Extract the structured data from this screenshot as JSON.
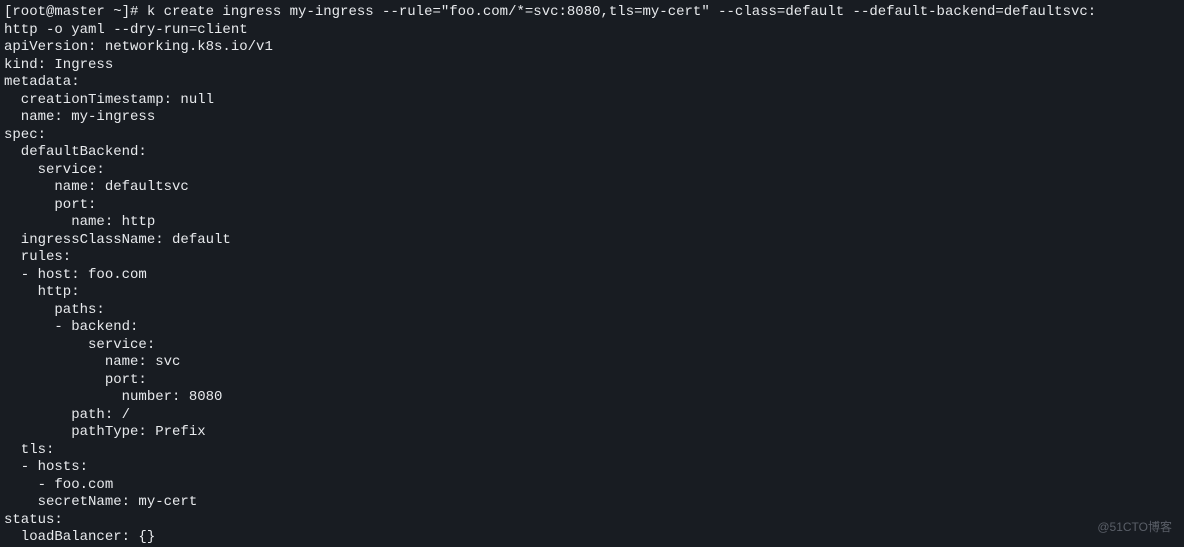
{
  "terminal": {
    "lines": [
      "[root@master ~]# k create ingress my-ingress --rule=\"foo.com/*=svc:8080,tls=my-cert\" --class=default --default-backend=defaultsvc:",
      "http -o yaml --dry-run=client",
      "apiVersion: networking.k8s.io/v1",
      "kind: Ingress",
      "metadata:",
      "  creationTimestamp: null",
      "  name: my-ingress",
      "spec:",
      "  defaultBackend:",
      "    service:",
      "      name: defaultsvc",
      "      port:",
      "        name: http",
      "  ingressClassName: default",
      "  rules:",
      "  - host: foo.com",
      "    http:",
      "      paths:",
      "      - backend:",
      "          service:",
      "            name: svc",
      "            port:",
      "              number: 8080",
      "        path: /",
      "        pathType: Prefix",
      "  tls:",
      "  - hosts:",
      "    - foo.com",
      "    secretName: my-cert",
      "status:",
      "  loadBalancer: {}"
    ]
  },
  "watermark": "@51CTO博客"
}
